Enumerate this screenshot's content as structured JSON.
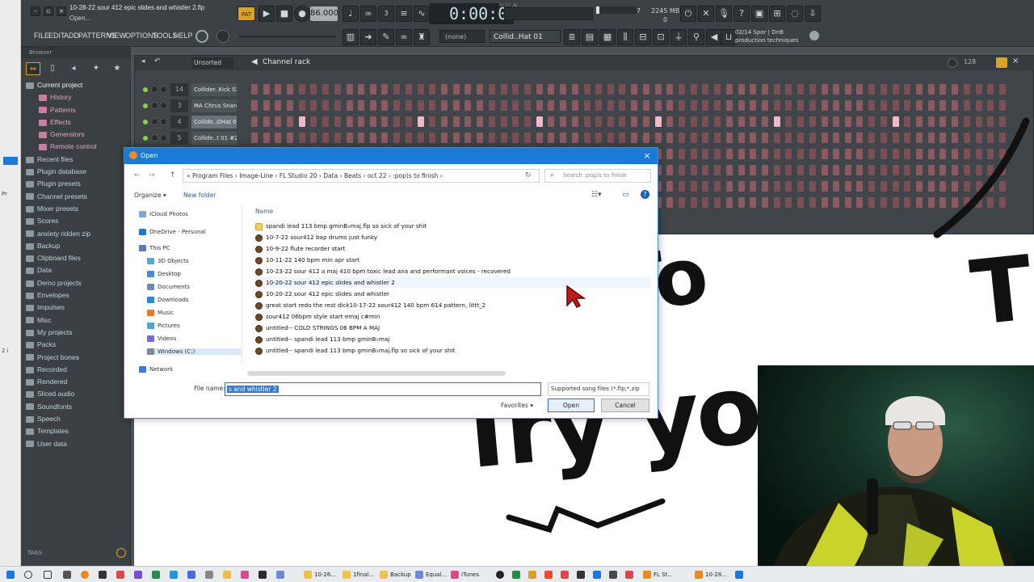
{
  "window": {
    "title": "10-28-22 sour 412 epic slides and whistler 2.flp",
    "subtitle": "Open...",
    "tempo": "86.000",
    "time": "0:00:00",
    "time_label": "MUSICAL",
    "cpu": "7",
    "memory": "2245 MB",
    "memory_sub": "0"
  },
  "menu": [
    "FILE",
    "EDIT",
    "ADD",
    "PATTERNS",
    "VIEW",
    "OPTIONS",
    "TOOLS",
    "HELP"
  ],
  "toolbar": {
    "pattern_select": "(none)",
    "channel_select": "Collid..Hat 01",
    "news_line1": "02/14  Spor | DnB",
    "news_line2": "production techniques"
  },
  "left_strip": {
    "a": "Pr",
    "b": "2 i"
  },
  "browser": {
    "header": "Browser",
    "items": [
      {
        "label": "Current project",
        "type": "cur"
      },
      {
        "label": "History",
        "type": "sub"
      },
      {
        "label": "Patterns",
        "type": "sub"
      },
      {
        "label": "Effects",
        "type": "sub"
      },
      {
        "label": "Generators",
        "type": "sub"
      },
      {
        "label": "Remote control",
        "type": "sub"
      },
      {
        "label": "Recent files",
        "type": "top"
      },
      {
        "label": "Plugin database",
        "type": "top"
      },
      {
        "label": "Plugin presets",
        "type": "top"
      },
      {
        "label": "Channel presets",
        "type": "top"
      },
      {
        "label": "Mixer presets",
        "type": "top"
      },
      {
        "label": "Scores",
        "type": "top"
      },
      {
        "label": "anxiety ridden zip",
        "type": "top"
      },
      {
        "label": "Backup",
        "type": "top"
      },
      {
        "label": "Clipboard files",
        "type": "top"
      },
      {
        "label": "Data",
        "type": "top"
      },
      {
        "label": "Demo projects",
        "type": "top"
      },
      {
        "label": "Envelopes",
        "type": "top"
      },
      {
        "label": "Impulses",
        "type": "top"
      },
      {
        "label": "Misc",
        "type": "top"
      },
      {
        "label": "My projects",
        "type": "top"
      },
      {
        "label": "Packs",
        "type": "top"
      },
      {
        "label": "Project bones",
        "type": "top"
      },
      {
        "label": "Recorded",
        "type": "top"
      },
      {
        "label": "Rendered",
        "type": "top"
      },
      {
        "label": "Sliced audio",
        "type": "top"
      },
      {
        "label": "Soundfonts",
        "type": "top"
      },
      {
        "label": "Speech",
        "type": "top"
      },
      {
        "label": "Templates",
        "type": "top"
      },
      {
        "label": "User data",
        "type": "top"
      }
    ],
    "tags": "TAGS"
  },
  "rack": {
    "title": "Channel rack",
    "sort": "Unsorted",
    "swing": "128",
    "channels": [
      {
        "num": "14",
        "name": "Collider..Kick 02",
        "hits": []
      },
      {
        "num": "3",
        "name": "MA Citrus Snare",
        "hits": []
      },
      {
        "num": "4",
        "name": "Collide..OHat 01",
        "hits": [
          4,
          14,
          24,
          34,
          44,
          54
        ]
      },
      {
        "num": "5",
        "name": "Collide..t 01 #2",
        "hits": []
      }
    ]
  },
  "art": {
    "w1": "To",
    "w2": "Try yo",
    "w3": "T"
  },
  "dialog": {
    "title": "Open",
    "path": "«  Program Files  ›  Image-Line  ›  FL Studio 20  ›  Data  ›  Beats  ›  oct 22  ›  :pop)s to finish  ›",
    "search_placeholder": "Search :pop)s to finish",
    "organize": "Organize ▾",
    "new_folder": "New folder",
    "column_name": "Name",
    "nav": [
      "iCloud Photos",
      "OneDrive - Personal",
      "This PC",
      "3D Objects",
      "Desktop",
      "Documents",
      "Downloads",
      "Music",
      "Pictures",
      "Videos",
      "Windows (C:)",
      "Network"
    ],
    "files": [
      {
        "name": "spandi lead 113 bmp gminB♭maj.flp so sick of your shit",
        "kind": "folder"
      },
      {
        "name": "10-7-22 sour412 bap drums just funky",
        "kind": "flp"
      },
      {
        "name": "10-9-22 flute recorder start",
        "kind": "flp"
      },
      {
        "name": "10-11-22 140 bpm min apr start",
        "kind": "flp"
      },
      {
        "name": "10-23-22 sour 412 a maj 410 bpm toxic lead ana and performant voices - recovered",
        "kind": "flp"
      },
      {
        "name": "10-20-22 sour 412 epic slides and whistler 2",
        "kind": "flp"
      },
      {
        "name": "10-20-22 sour 412 epic slides and whistler",
        "kind": "flp"
      },
      {
        "name": "great start redo the rest dick10-17-22 sour412 140 bpm 614 pattern, littt_2",
        "kind": "flp"
      },
      {
        "name": "sour412 06bpm style start emaj c#min",
        "kind": "flp"
      },
      {
        "name": "untitled-- COLD STRINGS 06 BPM A MAJ",
        "kind": "flp"
      },
      {
        "name": "untitled-- spandi lead 113 bmp gminB♭maj",
        "kind": "flp"
      },
      {
        "name": "untitled-- spandi lead 113 bmp gminB♭maj.flp so sick of your shit",
        "kind": "flp"
      }
    ],
    "filename_label": "File name:",
    "filename_value": "s and whistler 2",
    "filetype": "Supported song files (*.flp;*.zip",
    "favorites": "Favorites ▾",
    "open": "Open",
    "cancel": "Cancel"
  },
  "taskbar": [
    {
      "label": "10-26...",
      "color": "#e9c14a"
    },
    {
      "label": "1final...",
      "color": "#f0c24b"
    },
    {
      "label": "Backup",
      "color": "#f0c24b"
    },
    {
      "label": "Equal...",
      "color": "#6a8ad8"
    },
    {
      "label": "iTunes",
      "color": "#d84a8a"
    },
    {
      "label": "FL St...",
      "color": "#e88a20"
    },
    {
      "label": "10-28...",
      "color": "#e88a20"
    }
  ]
}
